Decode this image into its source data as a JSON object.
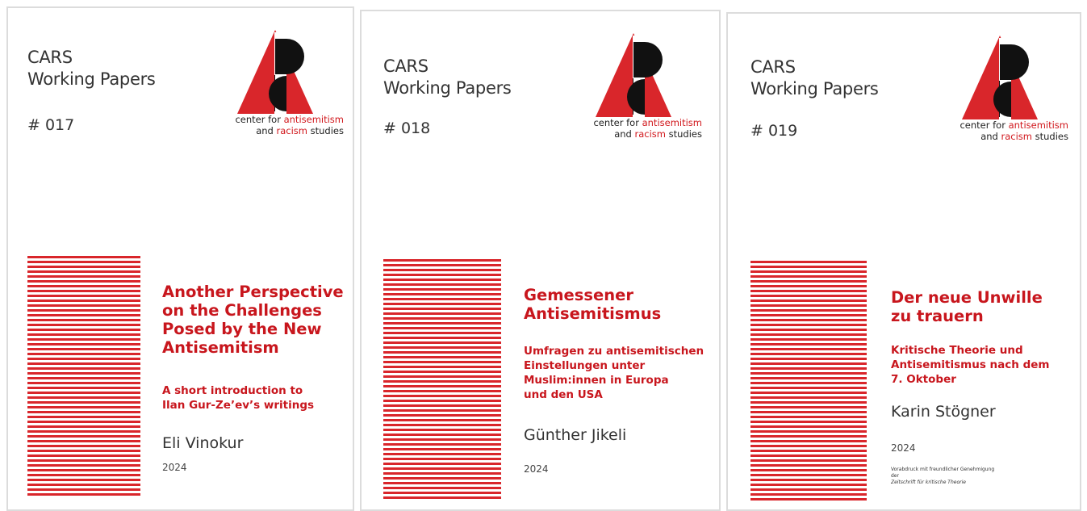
{
  "colors": {
    "brand_red": "#d9262b",
    "title_red": "#c8161d",
    "text_gray": "#333333"
  },
  "logo": {
    "icon": "cars-triangle-logo-icon",
    "line1_prefix": "center for ",
    "line1_highlight": "antisemitism",
    "line2_prefix": "and ",
    "line2_highlight": "racism",
    "line2_suffix": " studies"
  },
  "covers": [
    {
      "series_line1": "CARS",
      "series_line2": "Working Papers",
      "number": "# 017",
      "title_lines": [
        "Another Perspective",
        "on the Challenges",
        "Posed by the New",
        "Antisemitism"
      ],
      "subtitle_lines": [
        "A short introduction to",
        "Ilan Gur-Ze’ev’s writings"
      ],
      "author": "Eli Vinokur",
      "year": "2024"
    },
    {
      "series_line1": "CARS",
      "series_line2": "Working Papers",
      "number": "# 018",
      "title_lines": [
        "Gemessener",
        "Antisemitismus"
      ],
      "subtitle_lines": [
        "Umfragen zu antisemitischen",
        "Einstellungen unter",
        "Muslim:innen in Europa",
        "und den USA"
      ],
      "author": "Günther Jikeli",
      "year": "2024"
    },
    {
      "series_line1": "CARS",
      "series_line2": "Working Papers",
      "number": "# 019",
      "title_lines": [
        "Der neue Unwille",
        "zu trauern"
      ],
      "subtitle_lines": [
        "Kritische Theorie und",
        "Antisemitismus nach dem",
        "7. Oktober"
      ],
      "author": "Karin Stögner",
      "year": "2024",
      "note_line1": "Vorabdruck mit freundlicher Genehmigung",
      "note_line2_prefix": "der ",
      "note_line2_italic": "Zeitschrift für kritische Theorie"
    }
  ]
}
